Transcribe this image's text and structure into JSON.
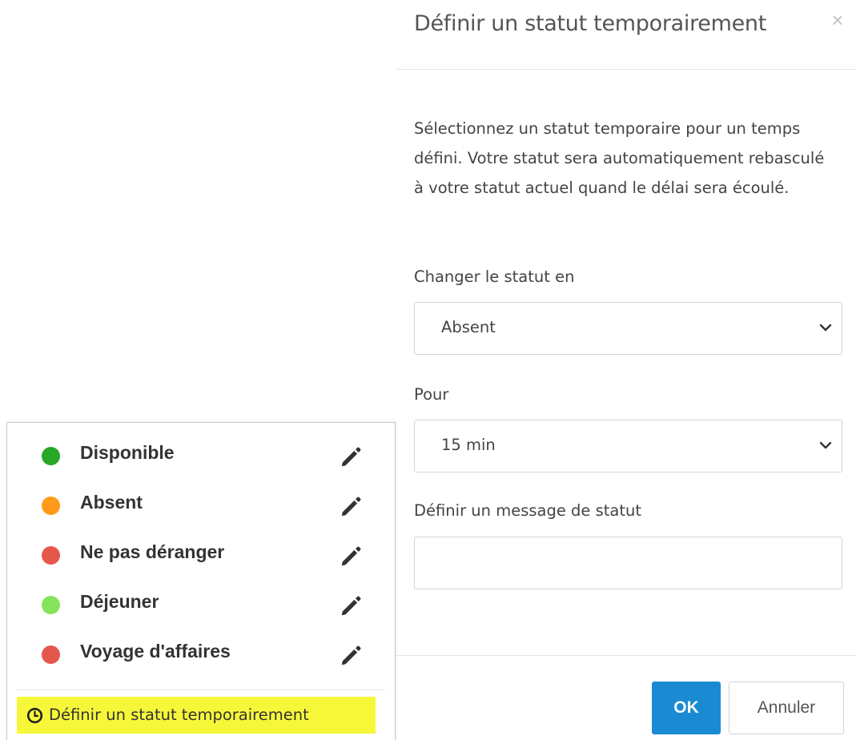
{
  "modal": {
    "title": "Définir un statut temporairement",
    "close_label": "×",
    "description": "Sélectionnez un statut temporaire pour un temps défini. Votre statut sera automatiquement rebasculé à votre statut actuel quand le délai sera écoulé.",
    "status_field": {
      "label": "Changer le statut en",
      "value": "Absent"
    },
    "duration_field": {
      "label": "Pour",
      "value": "15 min"
    },
    "message_field": {
      "label": "Définir un message de statut",
      "value": "",
      "placeholder": ""
    },
    "ok_label": "OK",
    "cancel_label": "Annuler",
    "colors": {
      "primary": "#1a8bd3"
    }
  },
  "status_menu": {
    "items": [
      {
        "label": "Disponible",
        "color": "#26a826"
      },
      {
        "label": "Absent",
        "color": "#ff9a1a"
      },
      {
        "label": "Ne pas déranger",
        "color": "#e5574c"
      },
      {
        "label": "Déjeuner",
        "color": "#86e35c"
      },
      {
        "label": "Voyage d'affaires",
        "color": "#e5574c"
      }
    ],
    "edit_icon": "pencil-icon",
    "temporary_link": {
      "label": "Définir un statut temporairement",
      "icon": "clock-icon",
      "highlight_color": "#f7f73a"
    }
  }
}
